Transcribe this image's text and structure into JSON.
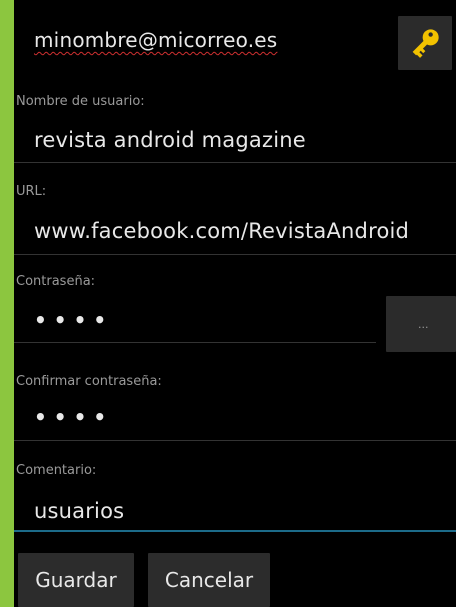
{
  "form": {
    "email": "minombre@micorreo.es",
    "username_label": "Nombre de usuario:",
    "username_value": "revista android magazine",
    "url_label": "URL:",
    "url_value": "www.facebook.com/RevistaAndroid",
    "password_label": "Contraseña:",
    "password_value": "••••",
    "password_more_label": "...",
    "confirm_label": "Confirmar contraseña:",
    "confirm_value": "••••",
    "comment_label": "Comentario:",
    "comment_value": "usuarios"
  },
  "buttons": {
    "save_label": "Guardar",
    "cancel_label": "Cancelar"
  },
  "colors": {
    "frame": "#8cc63f",
    "background": "#000000",
    "key_icon": "#f2c200"
  }
}
